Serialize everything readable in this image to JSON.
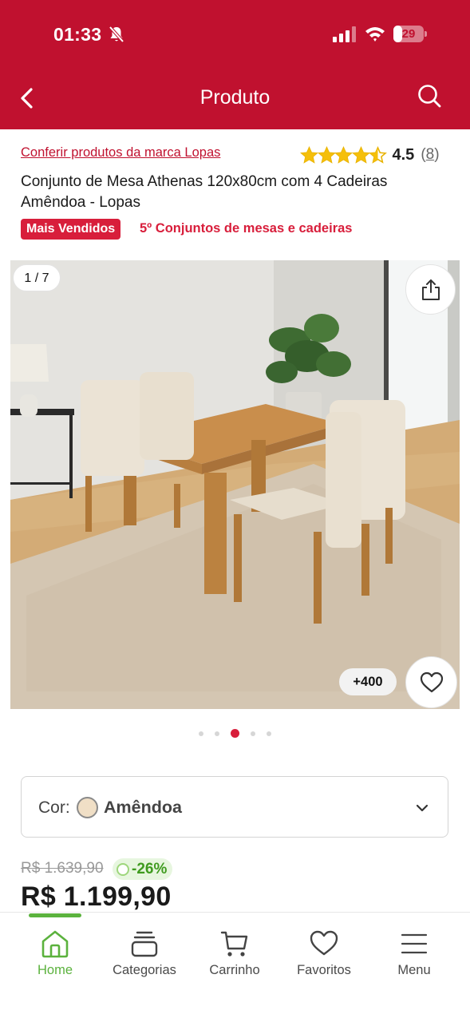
{
  "status_bar": {
    "time": "01:33",
    "battery": "29",
    "battery_level": 0.29
  },
  "header": {
    "title": "Produto"
  },
  "brand": {
    "link_text": "Conferir produtos da marca Lopas"
  },
  "rating": {
    "value": "4.5",
    "count": "8",
    "stars": 4.5
  },
  "product": {
    "title": "Conjunto de Mesa Athenas 120x80cm com 4 Cadeiras Amêndoa - Lopas",
    "badge": "Mais Vendidos",
    "ranking": "5º Conjuntos de mesas e cadeiras"
  },
  "gallery": {
    "counter": "1 / 7",
    "favorites_count": "+400",
    "dots_total": 5,
    "dots_active": 3
  },
  "color": {
    "label": "Cor:",
    "value": "Amêndoa",
    "swatch": "#f0dfc6"
  },
  "price": {
    "old": "R$ 1.639,90",
    "discount": "-26%",
    "current": "R$ 1.199,90"
  },
  "nav": {
    "items": [
      {
        "label": "Home",
        "icon": "home-icon"
      },
      {
        "label": "Categorias",
        "icon": "categories-icon"
      },
      {
        "label": "Carrinho",
        "icon": "cart-icon"
      },
      {
        "label": "Favoritos",
        "icon": "heart-icon"
      },
      {
        "label": "Menu",
        "icon": "menu-icon"
      }
    ]
  },
  "colors": {
    "brand_red": "#c0112f",
    "accent_red": "#d81e3b",
    "green": "#5bb23d"
  }
}
